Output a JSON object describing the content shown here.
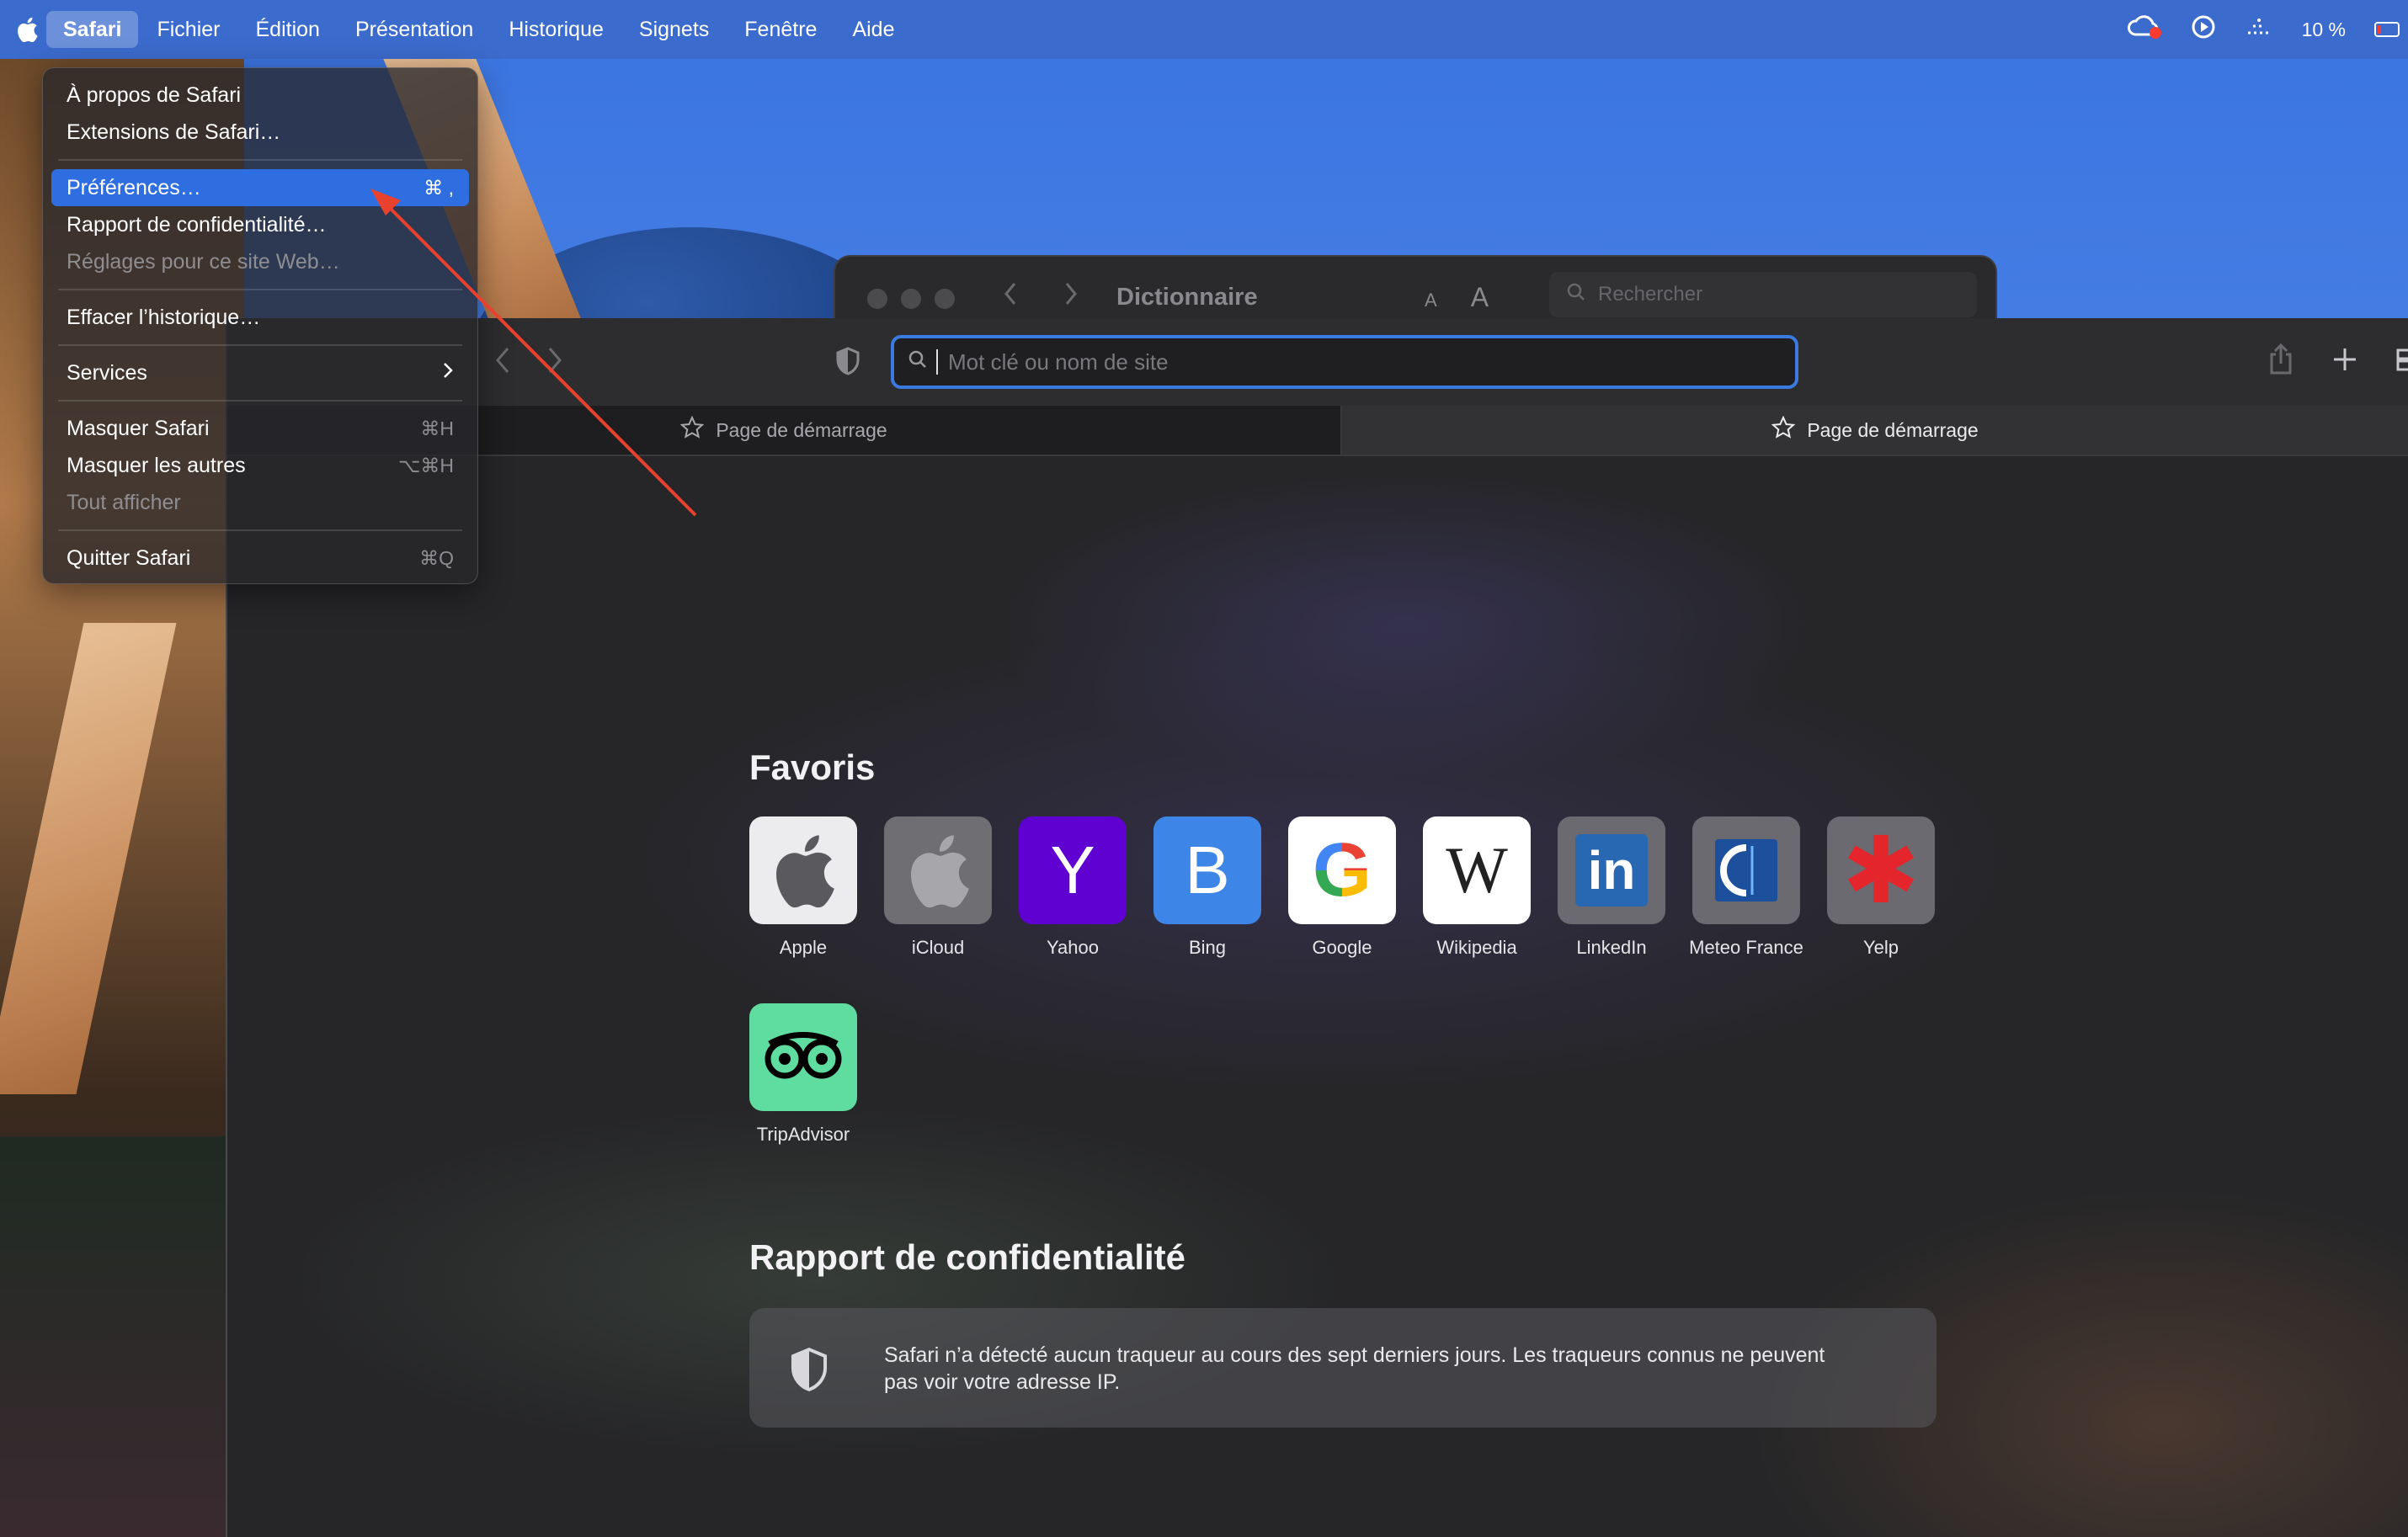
{
  "menubar": {
    "apple_icon": "apple-logo-icon",
    "items": [
      "Safari",
      "Fichier",
      "Édition",
      "Présentation",
      "Historique",
      "Signets",
      "Fenêtre",
      "Aide"
    ],
    "active_item": "Safari",
    "status": {
      "battery_percent": "10 %",
      "icons": [
        "creative-cloud-icon",
        "play-circle-icon",
        "weather-icon",
        "battery-icon"
      ]
    }
  },
  "app_menu": {
    "about": "À propos de Safari",
    "extensions": "Extensions de Safari…",
    "preferences": "Préférences…",
    "preferences_shortcut": "⌘ ,",
    "privacy_report": "Rapport de confidentialité…",
    "site_settings": "Réglages pour ce site Web…",
    "clear_history": "Effacer l’historique…",
    "services": "Services",
    "hide_safari": "Masquer Safari",
    "hide_safari_shortcut": "⌘H",
    "hide_others": "Masquer les autres",
    "hide_others_shortcut": "⌥⌘H",
    "show_all": "Tout afficher",
    "quit": "Quitter Safari",
    "quit_shortcut": "⌘Q",
    "highlight_color": "#2f6ee0"
  },
  "dictionary_window": {
    "title": "Dictionnaire",
    "font_small": "A",
    "font_large": "A",
    "search_placeholder": "Rechercher"
  },
  "safari": {
    "address_placeholder": "Mot clé ou nom de site",
    "tabs": [
      {
        "label": "Page de démarrage",
        "active": false
      },
      {
        "label": "Page de démarrage",
        "active": true
      }
    ],
    "favorites_title": "Favoris",
    "favorites": [
      {
        "label": "Apple",
        "glyph": "",
        "icon": "apple-logo-icon",
        "bg": "#ececee",
        "fg": "#5a5a5e"
      },
      {
        "label": "iCloud",
        "glyph": "",
        "icon": "apple-logo-icon",
        "bg": "#6e6e73",
        "fg": "#a7a7ab"
      },
      {
        "label": "Yahoo",
        "glyph": "Y",
        "icon": "yahoo-icon",
        "bg": "#5f01d1",
        "fg": "#ffffff"
      },
      {
        "label": "Bing",
        "glyph": "B",
        "icon": "bing-icon",
        "bg": "#3d86e8",
        "fg": "#ffffff"
      },
      {
        "label": "Google",
        "glyph": "G",
        "icon": "google-icon",
        "bg": "#ffffff",
        "fg": "#4285f4"
      },
      {
        "label": "Wikipedia",
        "glyph": "W",
        "icon": "wikipedia-icon",
        "bg": "#ffffff",
        "fg": "#222222"
      },
      {
        "label": "LinkedIn",
        "glyph": "in",
        "icon": "linkedin-icon",
        "bg": "#6a6a70",
        "fg": "#ffffff"
      },
      {
        "label": "Meteo France",
        "glyph": "",
        "icon": "meteo-france-icon",
        "bg": "#6a6a70",
        "fg": "#ffffff"
      },
      {
        "label": "Yelp",
        "glyph": "✱",
        "icon": "yelp-icon",
        "bg": "#6a6a70",
        "fg": "#e4262c"
      },
      {
        "label": "TripAdvisor",
        "glyph": "",
        "icon": "tripadvisor-icon",
        "bg": "#5fdca0",
        "fg": "#000000"
      }
    ],
    "privacy_title": "Rapport de confidentialité",
    "privacy_text": "Safari n’a détecté aucun traqueur au cours des sept derniers jours. Les traqueurs connus ne peuvent pas voir votre adresse IP."
  },
  "annotation": {
    "arrow_color": "#e8412e"
  }
}
